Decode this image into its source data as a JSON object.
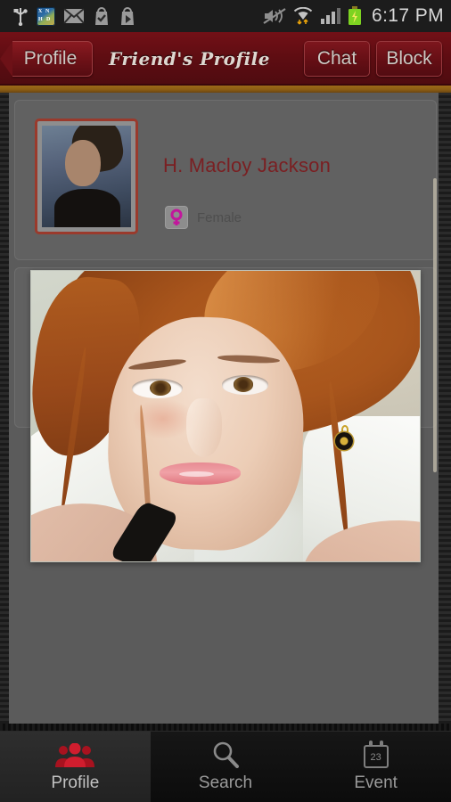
{
  "status_bar": {
    "clock": "6:17 PM",
    "left_icons": [
      {
        "name": "usb-icon"
      },
      {
        "name": "app-icon",
        "letters": [
          "X",
          "N",
          "H",
          "D"
        ]
      },
      {
        "name": "mail-icon"
      },
      {
        "name": "play-store-checkmark-icon"
      },
      {
        "name": "play-store-icon"
      }
    ],
    "right_icons": [
      {
        "name": "sound-mute-icon"
      },
      {
        "name": "wifi-icon"
      },
      {
        "name": "signal-bars-icon"
      },
      {
        "name": "battery-charging-icon"
      }
    ]
  },
  "title_bar": {
    "back_label": "Profile",
    "title": "Friend's Profile",
    "actions": [
      {
        "label": "Chat"
      },
      {
        "label": "Block"
      }
    ]
  },
  "profile": {
    "name": "H. Macloy Jackson",
    "gender_label": "Female",
    "gender_icon": "female-symbol-icon",
    "thumbnail_alt": "profile-thumbnail"
  },
  "photo_viewer": {
    "alt": "full-size-profile-photo"
  },
  "bottom_nav": {
    "items": [
      {
        "label": "Profile",
        "icon": "people-group-icon",
        "active": true
      },
      {
        "label": "Search",
        "icon": "magnifier-icon",
        "active": false
      },
      {
        "label": "Event",
        "icon": "calendar-icon",
        "day": "23",
        "active": false
      }
    ]
  },
  "colors": {
    "title_bar": "#5e0d12",
    "accent_red": "#7a1f22",
    "gold_divider": "#8a5b14",
    "content_bg": "#5b5b5b",
    "gender_magenta": "#c2169c",
    "nav_active_red": "#c01a2b"
  }
}
